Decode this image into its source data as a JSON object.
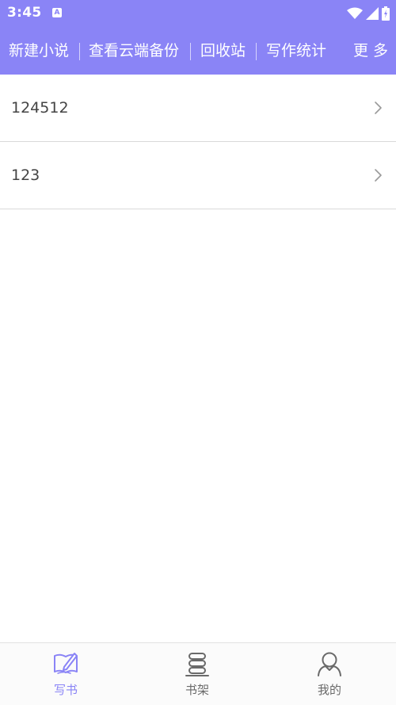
{
  "status_bar": {
    "time": "3:45",
    "app_icon": "A"
  },
  "toolbar": {
    "items": [
      {
        "label": "新建小说"
      },
      {
        "label": "查看云端备份"
      },
      {
        "label": "回收站"
      },
      {
        "label": "写作统计"
      }
    ],
    "more_label": "更 多"
  },
  "novels": [
    {
      "title": "124512"
    },
    {
      "title": "123"
    }
  ],
  "bottom_nav": {
    "tabs": [
      {
        "label": "写书",
        "icon": "write-book-icon",
        "active": true
      },
      {
        "label": "书架",
        "icon": "bookshelf-icon",
        "active": false
      },
      {
        "label": "我的",
        "icon": "profile-icon",
        "active": false
      }
    ]
  },
  "colors": {
    "accent": "#8a84f6",
    "text": "#444444",
    "nav_inactive": "#6a6a6a"
  }
}
